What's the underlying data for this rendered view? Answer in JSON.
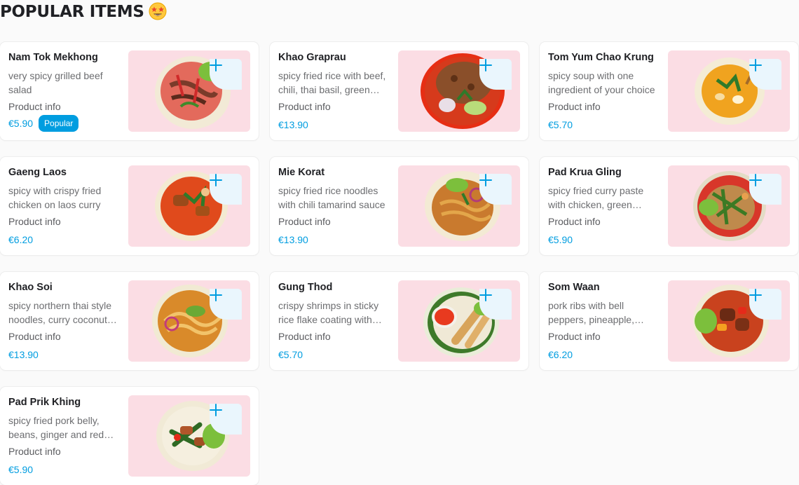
{
  "section": {
    "title": "POPULAR ITEMS",
    "title_icon": "star-struck-emoji-icon"
  },
  "colors": {
    "accent": "#009de0",
    "card_bg": "#ffffff",
    "image_bg": "#fbdde4",
    "add_button_bg": "#eaf6fd"
  },
  "items": [
    {
      "name": "Nam Tok Mekhong",
      "description": "very spicy grilled beef salad",
      "info": "Product info",
      "price": "€5.90",
      "badge": "Popular",
      "dish": "salad"
    },
    {
      "name": "Khao Graprau",
      "description": "spicy fried rice with beef, chili, thai basil, green beans",
      "info": "Product info",
      "price": "€13.90",
      "dish": "rice"
    },
    {
      "name": "Tom Yum Chao Krung",
      "description": "spicy soup with one ingredient of your choice",
      "info": "Product info",
      "price": "€5.70",
      "dish": "soup"
    },
    {
      "name": "Gaeng Laos",
      "description": "spicy with crispy fried chicken on laos curry",
      "info": "Product info",
      "price": "€6.20",
      "dish": "curry"
    },
    {
      "name": "Mie Korat",
      "description": "spicy fried rice noodles with chili tamarind sauce",
      "info": "Product info",
      "price": "€13.90",
      "dish": "noodles"
    },
    {
      "name": "Pad Krua Gling",
      "description": "spicy fried curry paste with chicken, green beans",
      "info": "Product info",
      "price": "€5.90",
      "dish": "stirfry"
    },
    {
      "name": "Khao Soi",
      "description": "spicy northern thai style noodles, curry coconut soup",
      "info": "Product info",
      "price": "€13.90",
      "dish": "khaosoi"
    },
    {
      "name": "Gung Thod",
      "description": "crispy shrimps in sticky rice flake coating with sweet chili sauce",
      "info": "Product info",
      "price": "€5.70",
      "dish": "shrimp"
    },
    {
      "name": "Som Waan",
      "description": "pork ribs with bell peppers, pineapple, tomatoes",
      "info": "Product info",
      "price": "€6.20",
      "dish": "pork"
    },
    {
      "name": "Pad Prik Khing",
      "description": "spicy fried pork belly, beans, ginger and red curry paste",
      "info": "Product info",
      "price": "€5.90",
      "dish": "porkbelly"
    }
  ]
}
